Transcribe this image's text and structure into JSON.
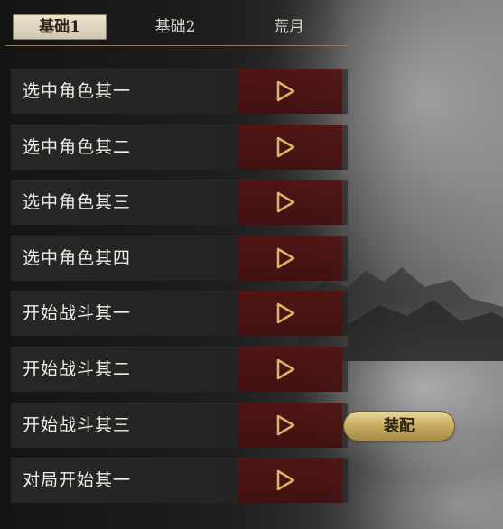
{
  "tabs": [
    {
      "label": "基础1",
      "active": true
    },
    {
      "label": "基础2",
      "active": false
    },
    {
      "label": "荒月",
      "active": false
    }
  ],
  "rows": [
    {
      "label": "选中角色其一",
      "action_icon": "play-triangle-icon"
    },
    {
      "label": "选中角色其二",
      "action_icon": "play-triangle-icon"
    },
    {
      "label": "选中角色其三",
      "action_icon": "play-triangle-icon"
    },
    {
      "label": "选中角色其四",
      "action_icon": "play-triangle-icon"
    },
    {
      "label": "开始战斗其一",
      "action_icon": "play-triangle-icon"
    },
    {
      "label": "开始战斗其二",
      "action_icon": "play-triangle-icon"
    },
    {
      "label": "开始战斗其三",
      "action_icon": "play-triangle-icon"
    },
    {
      "label": "对局开始其一",
      "action_icon": "play-triangle-icon"
    }
  ],
  "equip_button": {
    "label": "装配"
  },
  "colors": {
    "accent_gold": "#c9ae63",
    "row_red": "#581212",
    "tab_active_bg": "#ece5d2",
    "text_light": "#f1ede4"
  }
}
